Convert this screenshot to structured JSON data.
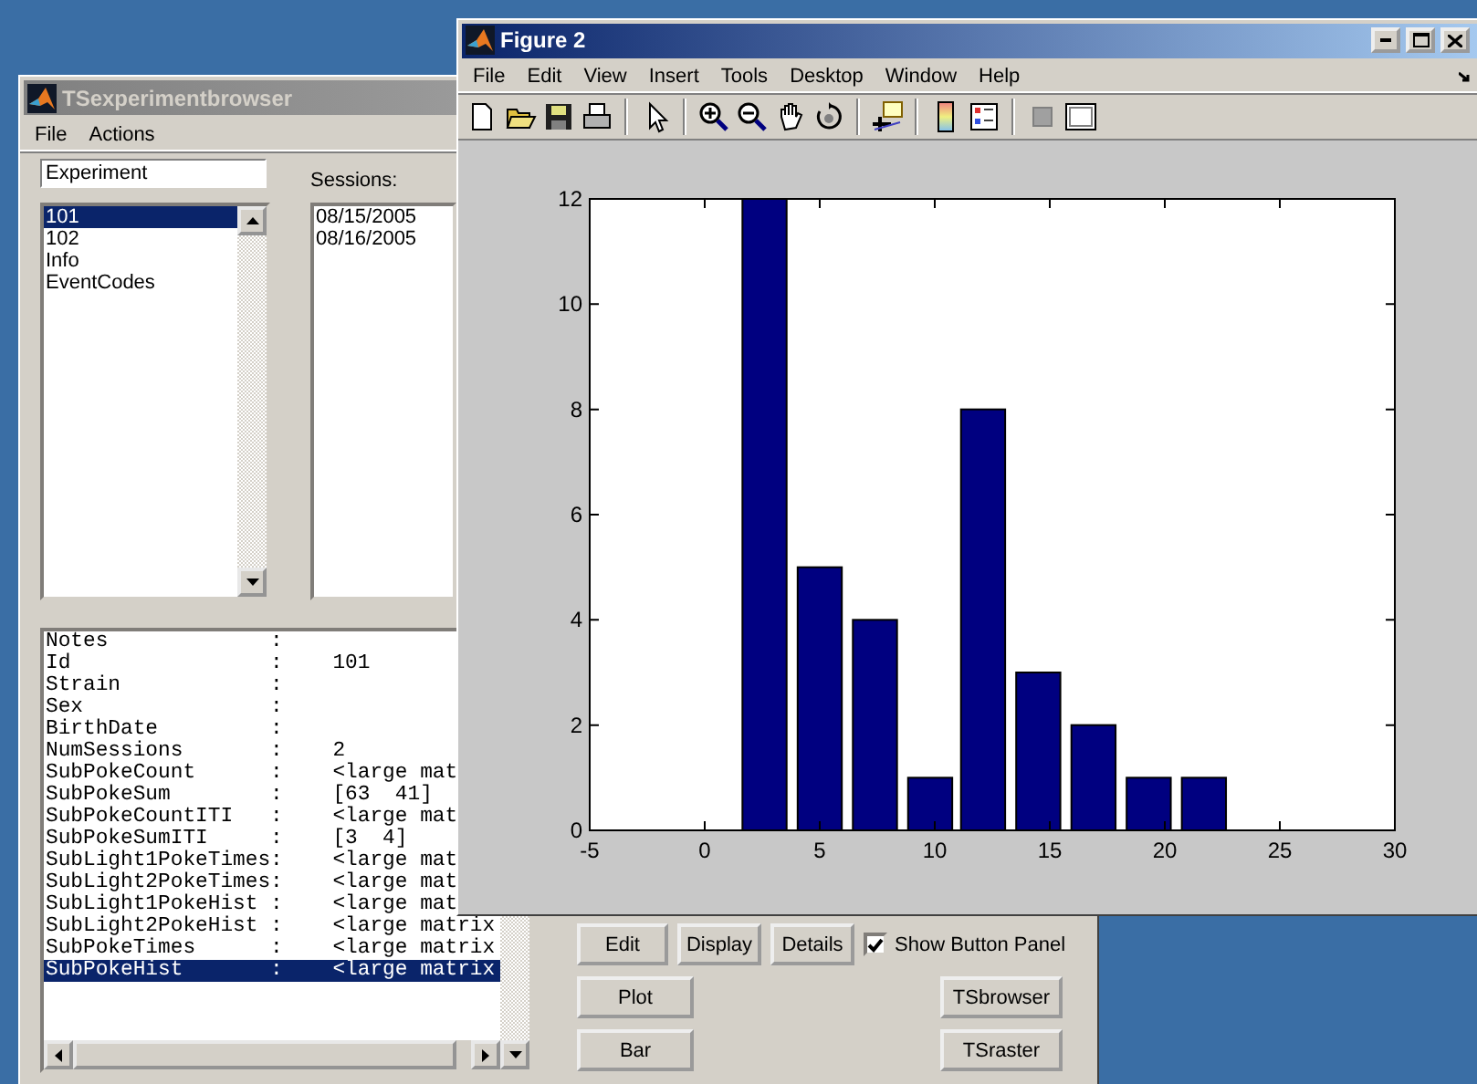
{
  "browser": {
    "title": "TSexperimentbrowser",
    "menu": [
      "File",
      "Actions"
    ],
    "experiment_field": {
      "value": "Experiment"
    },
    "sessions_label": "Sessions:",
    "experiment_list": [
      {
        "label": "101",
        "selected": true
      },
      {
        "label": "102",
        "selected": false
      },
      {
        "label": "Info",
        "selected": false
      },
      {
        "label": "EventCodes",
        "selected": false
      }
    ],
    "sessions_list": [
      {
        "label": "08/15/2005",
        "selected": false
      },
      {
        "label": "08/16/2005",
        "selected": false
      }
    ],
    "details": [
      {
        "text": "Notes             :",
        "selected": false
      },
      {
        "text": "Id                :    101",
        "selected": false
      },
      {
        "text": "Strain            :",
        "selected": false
      },
      {
        "text": "Sex               :",
        "selected": false
      },
      {
        "text": "BirthDate         :",
        "selected": false
      },
      {
        "text": "NumSessions       :    2",
        "selected": false
      },
      {
        "text": "SubPokeCount      :    <large mat",
        "selected": false
      },
      {
        "text": "SubPokeSum        :    [63  41]",
        "selected": false
      },
      {
        "text": "SubPokeCountITI   :    <large mat",
        "selected": false
      },
      {
        "text": "SubPokeSumITI     :    [3  4]",
        "selected": false
      },
      {
        "text": "SubLight1PokeTimes:    <large mat",
        "selected": false
      },
      {
        "text": "SubLight2PokeTimes:    <large mat",
        "selected": false
      },
      {
        "text": "SubLight1PokeHist :    <large mat",
        "selected": false
      },
      {
        "text": "SubLight2PokeHist :    <large matrix",
        "selected": false
      },
      {
        "text": "SubPokeTimes      :    <large matrix",
        "selected": false
      },
      {
        "text": "SubPokeHist       :    <large matrix",
        "selected": true
      }
    ],
    "buttons_row": [
      "Edit",
      "Display",
      "Details"
    ],
    "show_panel": {
      "label": "Show Button Panel",
      "checked": true
    },
    "left_buttons": [
      "Plot",
      "Bar"
    ],
    "right_buttons": [
      "TSbrowser",
      "TSraster"
    ]
  },
  "figure": {
    "title": "Figure 2",
    "menu": [
      "File",
      "Edit",
      "View",
      "Insert",
      "Tools",
      "Desktop",
      "Window",
      "Help"
    ],
    "chart_data": {
      "type": "bar",
      "x": [
        2.6,
        5.0,
        7.4,
        9.8,
        12.1,
        14.5,
        16.9,
        19.3,
        21.7
      ],
      "series": [
        {
          "color": "#000080",
          "values": [
            12,
            5,
            4,
            1,
            8,
            3,
            2,
            1,
            1
          ]
        }
      ],
      "xlim": [
        -5,
        30
      ],
      "ylim": [
        0,
        12
      ],
      "xticks": [
        -5,
        0,
        5,
        10,
        15,
        20,
        25,
        30
      ],
      "yticks": [
        0,
        2,
        4,
        6,
        8,
        10,
        12
      ]
    }
  }
}
